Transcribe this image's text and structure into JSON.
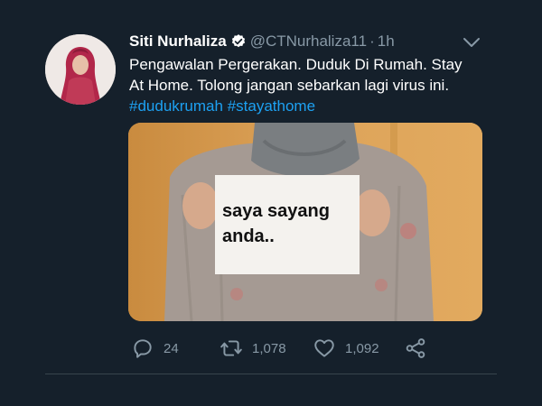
{
  "tweet": {
    "author_name": "Siti Nurhaliza",
    "handle": "@CTNurhaliza11",
    "separator": "·",
    "time": "1h",
    "text_lines": [
      "Pengawalan Pergerakan. Duduk Di Rumah. Stay",
      "At Home. Tolong jangan sebarkan lagi virus ini."
    ],
    "hashtags": [
      "#dudukrumah",
      "#stayathome"
    ],
    "media": {
      "sign_text_lines": [
        "saya sayang",
        "anda.."
      ]
    },
    "actions": {
      "reply_count": "24",
      "retweet_count": "1,078",
      "like_count": "1,092"
    }
  },
  "colors": {
    "background": "#15202b",
    "link": "#1da1f2",
    "secondary_text": "#8899a6",
    "divider": "#38444d"
  },
  "icons": {
    "verified": "verified-badge-icon",
    "caret": "chevron-down-icon",
    "reply": "reply-icon",
    "retweet": "retweet-icon",
    "like": "heart-icon",
    "share": "share-icon"
  }
}
